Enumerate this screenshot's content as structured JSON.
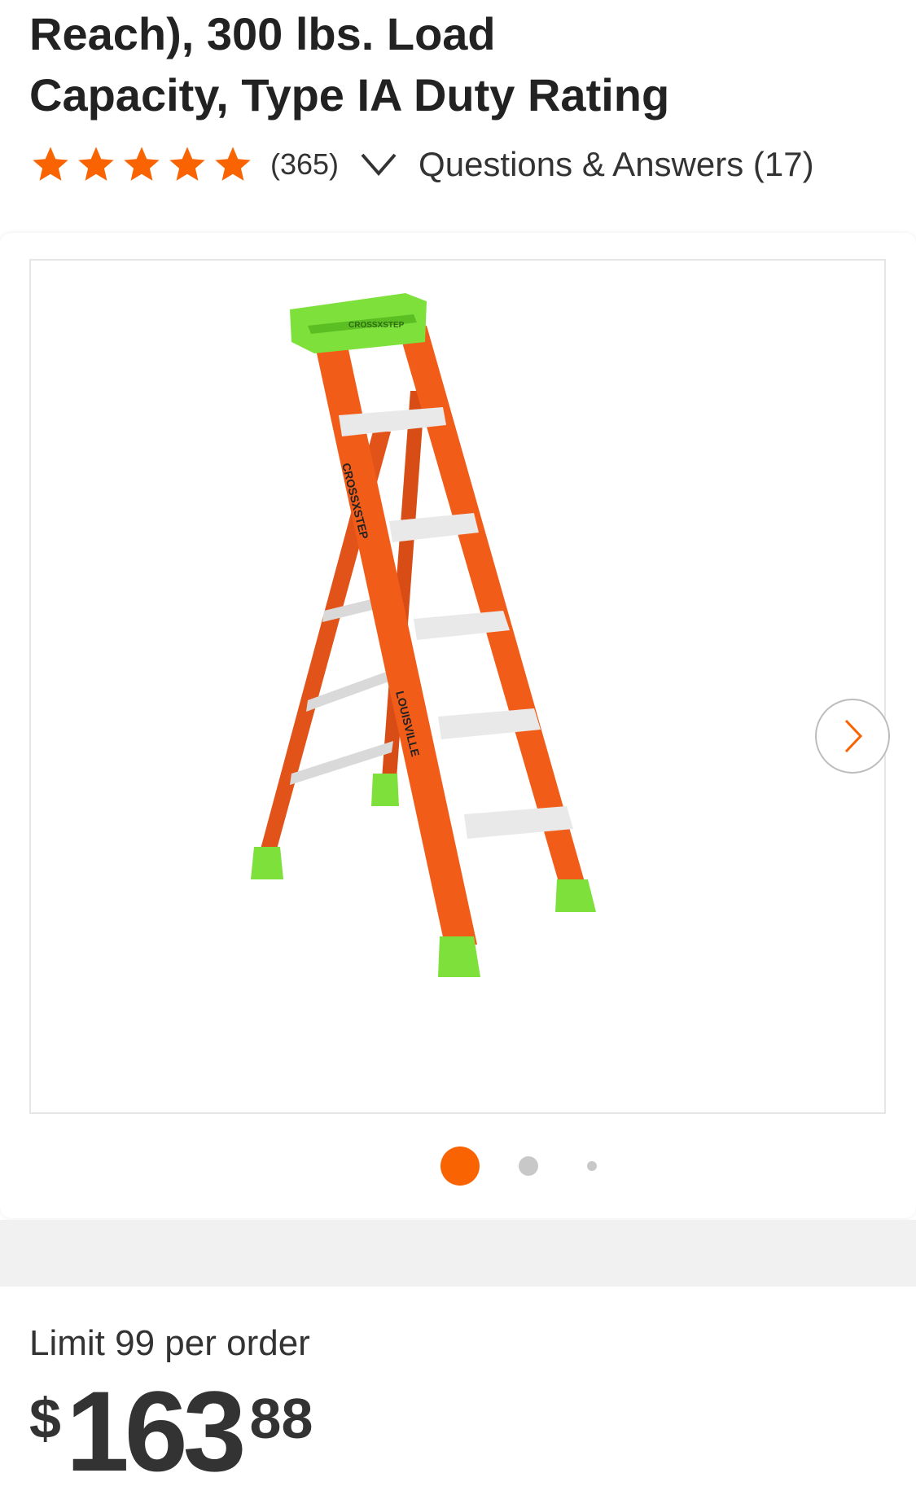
{
  "product": {
    "title_line1": "Reach), 300 lbs. Load",
    "title_line2": "Capacity, Type IA Duty Rating",
    "review_count": "(365)",
    "questions_link": "Questions & Answers (17)",
    "rating": 5,
    "rating_max": 5
  },
  "gallery": {
    "image_count": 3,
    "active_index": 0,
    "image_label_top": "CROSSXSTEP",
    "image_label_left_rail": "CROSSXSTEP",
    "image_label_right_rail": "LOUISVILLE"
  },
  "purchase": {
    "limit_text": "Limit 99 per order",
    "price_currency": "$",
    "price_dollars": "163",
    "price_cents": "88"
  },
  "colors": {
    "accent": "#f96302",
    "ladder_rail": "#f25c19",
    "ladder_cap": "#7ee03b",
    "star": "#f96302"
  },
  "icons": {
    "star": "star-icon",
    "chevron_down": "chevron-down-icon",
    "next": "chevron-right-icon"
  }
}
